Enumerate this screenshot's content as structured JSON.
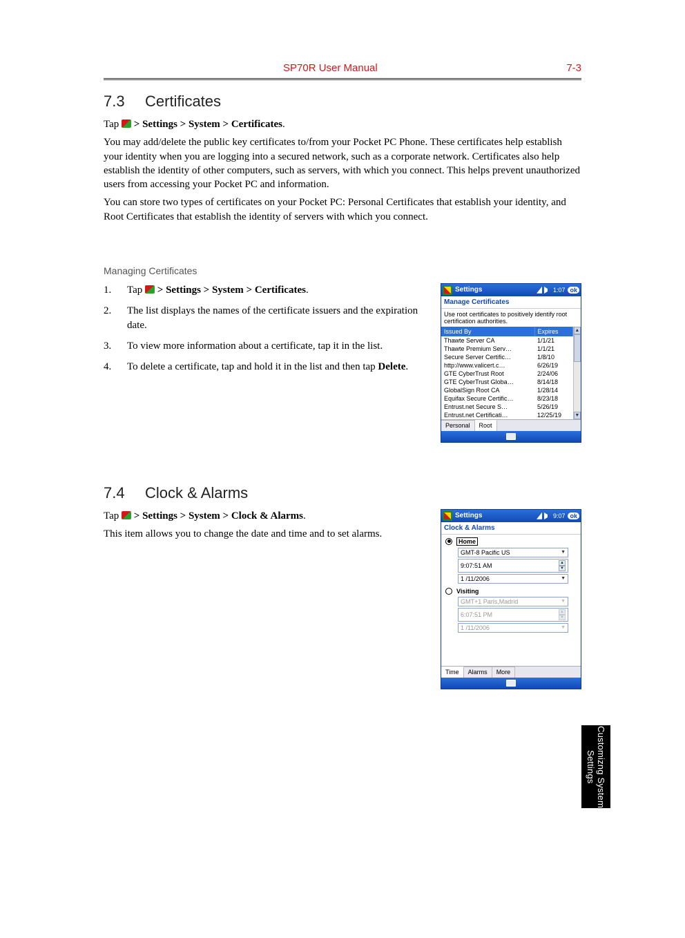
{
  "header": {
    "title": "SP70R User Manual",
    "page_number": "7-3"
  },
  "side_tab": "Customizng System Settings",
  "section73": {
    "number": "7.3",
    "title": "Certificates",
    "nav_prefix": "Tap ",
    "nav_path": " > Settings > System > Certificates",
    "nav_suffix": ".",
    "para1": "You may add/delete the public key certificates to/from your Pocket PC Phone. These certificates help establish your identity when you are logging into a secured network, such as a corporate network. Certificates also help establish the identity of other computers, such as servers, with which you connect. This helps prevent unauthorized users from accessing your Pocket PC and information.",
    "para2": "You can store two types of certificates on your Pocket PC: Personal Certificates that establish your identity, and Root Certificates that establish the identity of servers with which you connect.",
    "subhead": "Managing Certificates",
    "steps": {
      "s1_prefix": "Tap ",
      "s1_path": " > Settings > System > Certificates",
      "s1_suffix": ".",
      "s2": "The list displays the names of the certificate issuers and the expiration date.",
      "s3": "To view more information about a certificate, tap it in the list.",
      "s4_prefix": "To delete a certificate, tap and hold it in the list and then tap ",
      "s4_bold": "Delete",
      "s4_suffix": "."
    }
  },
  "section74": {
    "number": "7.4",
    "title": "Clock & Alarms",
    "nav_prefix": "Tap ",
    "nav_path": " > Settings > System > Clock & Alarms",
    "nav_suffix": ".",
    "para1": "This item allows you to change the date and time and to set alarms."
  },
  "ppc_cert": {
    "titlebar": {
      "app": "Settings",
      "time": "1:07",
      "ok": "ok"
    },
    "subtitle": "Manage Certificates",
    "desc": "Use root certificates to positively identify root certification authorities.",
    "cols": {
      "c1": "Issued By",
      "c2": "Expires"
    },
    "rows": [
      {
        "by": "Thawte Server CA",
        "exp": "1/1/21"
      },
      {
        "by": "Thawte Premium Serv…",
        "exp": "1/1/21"
      },
      {
        "by": "Secure Server Certific…",
        "exp": "1/8/10"
      },
      {
        "by": "http://www.valicert.c…",
        "exp": "6/26/19"
      },
      {
        "by": "GTE CyberTrust Root",
        "exp": "2/24/06"
      },
      {
        "by": "GTE CyberTrust Globa…",
        "exp": "8/14/18"
      },
      {
        "by": "GlobalSign Root CA",
        "exp": "1/28/14"
      },
      {
        "by": "Equifax Secure Certific…",
        "exp": "8/23/18"
      },
      {
        "by": "Entrust.net Secure S…",
        "exp": "5/26/19"
      },
      {
        "by": "Entrust.net Certificati…",
        "exp": "12/25/19"
      }
    ],
    "tabs": {
      "t1": "Personal",
      "t2": "Root"
    }
  },
  "ppc_clock": {
    "titlebar": {
      "app": "Settings",
      "time": "9:07",
      "ok": "ok"
    },
    "subtitle": "Clock & Alarms",
    "home": {
      "label": "Home",
      "tz": "GMT-8 Pacific US",
      "time": "9:07:51 AM",
      "date": "1 /11/2006"
    },
    "visiting": {
      "label": "Visiting",
      "tz": "GMT+1 Paris,Madrid",
      "time": "6:07:51 PM",
      "date": "1 /11/2006"
    },
    "tabs": {
      "t1": "Time",
      "t2": "Alarms",
      "t3": "More"
    }
  }
}
